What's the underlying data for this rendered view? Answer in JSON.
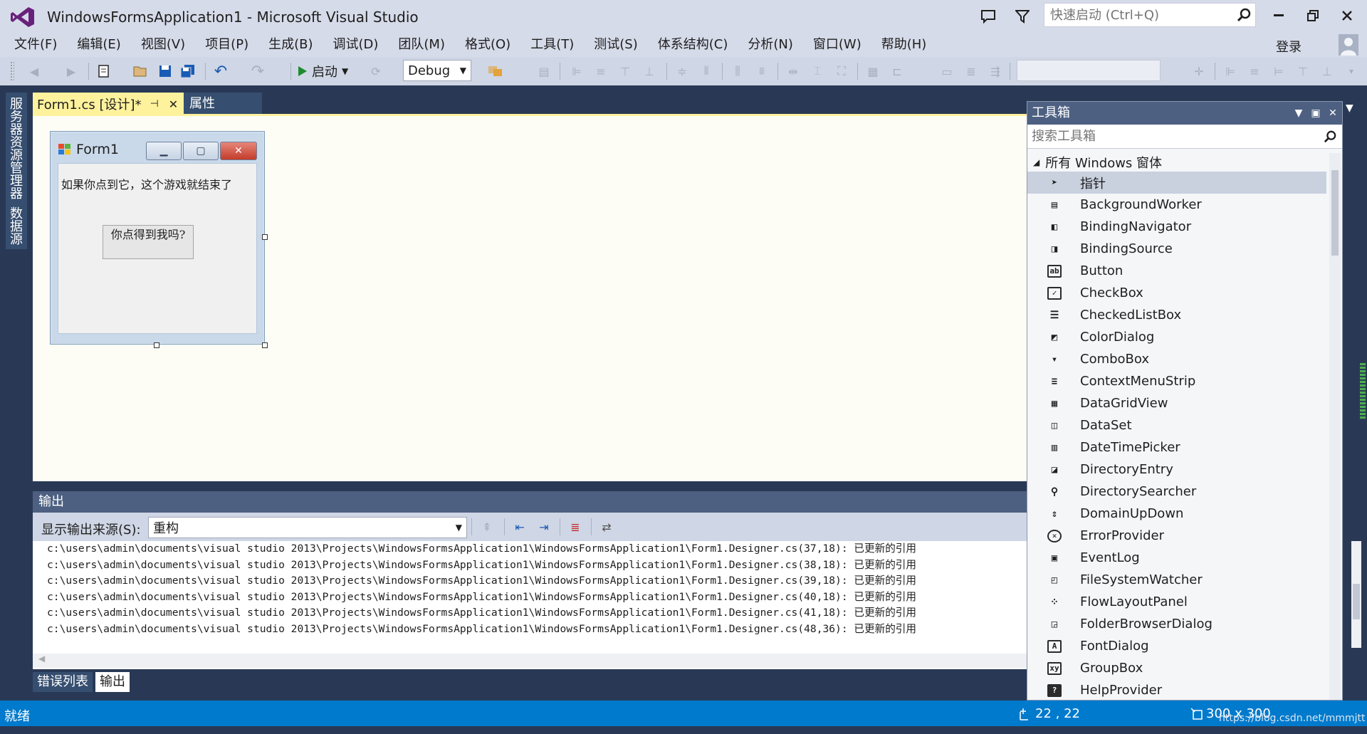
{
  "window": {
    "title": "WindowsFormsApplication1 - Microsoft Visual Studio",
    "quick_launch_placeholder": "快速启动 (Ctrl+Q)",
    "sign_in": "登录"
  },
  "menu": [
    "文件(F)",
    "编辑(E)",
    "视图(V)",
    "项目(P)",
    "生成(B)",
    "调试(D)",
    "团队(M)",
    "格式(O)",
    "工具(T)",
    "测试(S)",
    "体系结构(C)",
    "分析(N)",
    "窗口(W)",
    "帮助(H)"
  ],
  "toolbar": {
    "start_label": "启动",
    "config": "Debug"
  },
  "left_tabs": [
    "服务器资源管理器",
    "数据源"
  ],
  "doc_tabs": {
    "active": "Form1.cs [设计]*",
    "other": "属性"
  },
  "form": {
    "title": "Form1",
    "label_text": "如果你点到它，这个游戏就结束了",
    "button_text": "你点得到我吗?"
  },
  "output": {
    "header": "输出",
    "source_label": "显示输出来源(S):",
    "source_value": "重构",
    "lines": [
      "c:\\users\\admin\\documents\\visual studio 2013\\Projects\\WindowsFormsApplication1\\WindowsFormsApplication1\\Form1.Designer.cs(37,18): 已更新的引用",
      "c:\\users\\admin\\documents\\visual studio 2013\\Projects\\WindowsFormsApplication1\\WindowsFormsApplication1\\Form1.Designer.cs(38,18): 已更新的引用",
      "c:\\users\\admin\\documents\\visual studio 2013\\Projects\\WindowsFormsApplication1\\WindowsFormsApplication1\\Form1.Designer.cs(39,18): 已更新的引用",
      "c:\\users\\admin\\documents\\visual studio 2013\\Projects\\WindowsFormsApplication1\\WindowsFormsApplication1\\Form1.Designer.cs(40,18): 已更新的引用",
      "c:\\users\\admin\\documents\\visual studio 2013\\Projects\\WindowsFormsApplication1\\WindowsFormsApplication1\\Form1.Designer.cs(41,18): 已更新的引用",
      "c:\\users\\admin\\documents\\visual studio 2013\\Projects\\WindowsFormsApplication1\\WindowsFormsApplication1\\Form1.Designer.cs(48,36): 已更新的引用"
    ]
  },
  "bottom_tabs": [
    "错误列表",
    "输出"
  ],
  "status": {
    "text": "就绪",
    "position": "22 , 22",
    "size": "300 x 300",
    "watermark": "https://blog.csdn.net/mmmjtt"
  },
  "toolbox": {
    "title": "工具箱",
    "search_placeholder": "搜索工具箱",
    "group": "所有 Windows 窗体",
    "items": [
      {
        "label": "指针",
        "icon": "pointer-icon"
      },
      {
        "label": "BackgroundWorker",
        "icon": "backgroundworker-icon"
      },
      {
        "label": "BindingNavigator",
        "icon": "bindingnavigator-icon"
      },
      {
        "label": "BindingSource",
        "icon": "bindingsource-icon"
      },
      {
        "label": "Button",
        "icon": "button-icon"
      },
      {
        "label": "CheckBox",
        "icon": "checkbox-icon"
      },
      {
        "label": "CheckedListBox",
        "icon": "checkedlistbox-icon"
      },
      {
        "label": "ColorDialog",
        "icon": "colordialog-icon"
      },
      {
        "label": "ComboBox",
        "icon": "combobox-icon"
      },
      {
        "label": "ContextMenuStrip",
        "icon": "contextmenustrip-icon"
      },
      {
        "label": "DataGridView",
        "icon": "datagridview-icon"
      },
      {
        "label": "DataSet",
        "icon": "dataset-icon"
      },
      {
        "label": "DateTimePicker",
        "icon": "datetimepicker-icon"
      },
      {
        "label": "DirectoryEntry",
        "icon": "directoryentry-icon"
      },
      {
        "label": "DirectorySearcher",
        "icon": "directorysearcher-icon"
      },
      {
        "label": "DomainUpDown",
        "icon": "domainupdown-icon"
      },
      {
        "label": "ErrorProvider",
        "icon": "errorprovider-icon"
      },
      {
        "label": "EventLog",
        "icon": "eventlog-icon"
      },
      {
        "label": "FileSystemWatcher",
        "icon": "filesystemwatcher-icon"
      },
      {
        "label": "FlowLayoutPanel",
        "icon": "flowlayoutpanel-icon"
      },
      {
        "label": "FolderBrowserDialog",
        "icon": "folderbrowserdialog-icon"
      },
      {
        "label": "FontDialog",
        "icon": "fontdialog-icon"
      },
      {
        "label": "GroupBox",
        "icon": "groupbox-icon"
      },
      {
        "label": "HelpProvider",
        "icon": "helpprovider-icon"
      }
    ]
  },
  "colors": {
    "accent": "#007acc",
    "chrome": "#d6dbe9",
    "dark": "#293955",
    "active_tab": "#fff29d"
  }
}
